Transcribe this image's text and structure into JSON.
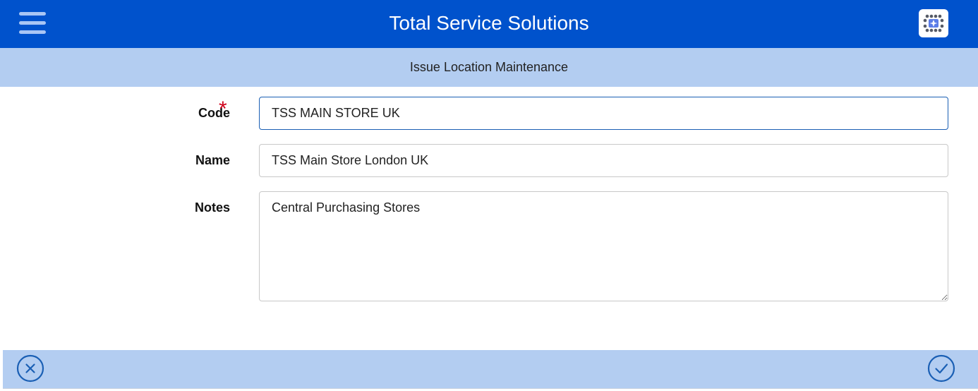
{
  "header": {
    "app_title": "Total Service Solutions",
    "menu_icon": "hamburger-menu-icon",
    "logo_icon": "app-logo-icon",
    "background_color": "#0052cc"
  },
  "subheader": {
    "page_title": "Issue Location Maintenance",
    "background_color": "#b3cdf1"
  },
  "form": {
    "code": {
      "label": "Code",
      "required_marker": "*",
      "value": "TSS MAIN STORE UK"
    },
    "name": {
      "label": "Name",
      "value": "TSS Main Store London UK"
    },
    "notes": {
      "label": "Notes",
      "value": "Central Purchasing Stores"
    }
  },
  "footer": {
    "cancel_icon": "close-circle-icon",
    "confirm_icon": "check-circle-icon",
    "icon_color": "#1a5fb4"
  }
}
